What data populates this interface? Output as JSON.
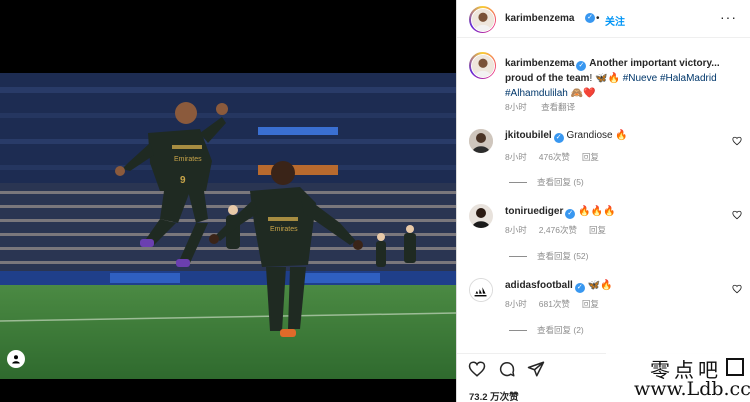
{
  "post": {
    "author": "karimbenzema",
    "follow_label": "关注",
    "caption_parts": [
      {
        "text": "Another important victory...",
        "bold": true
      },
      {
        "text": "proud of the team",
        "bold": true
      },
      {
        "text": "! 🦋🔥 ",
        "bold": false
      },
      {
        "text": "#Nueve",
        "tag": true
      },
      {
        "text": "#HalaMadrid",
        "tag": true
      },
      {
        "text": "#Alhamdulilah",
        "tag": true
      }
    ],
    "caption_line1": "Another important victory...",
    "caption_line2_bold": "proud of the team",
    "caption_line2_rest": "! 🦋🔥",
    "tag1": "#Nueve",
    "tag2": "#HalaMadrid",
    "tag3": "#Alhamdulilah",
    "caption_end_emoji": "🙈❤️",
    "time": "8小时",
    "translate_label": "查看翻译",
    "likes_label": "73.2 万次赞"
  },
  "comments": [
    {
      "user": "jkitoubilel",
      "verified": true,
      "text": "Grandiose 🔥",
      "time": "8小时",
      "likes": "476次赞",
      "reply": "回复",
      "view_replies": "查看回复 (5)"
    },
    {
      "user": "toniruediger",
      "verified": true,
      "text": "🔥🔥🔥",
      "time": "8小时",
      "likes": "2,476次赞",
      "reply": "回复",
      "view_replies": "查看回复 (52)"
    },
    {
      "user": "adidasfootball",
      "verified": true,
      "text": "🦋🔥",
      "time": "8小时",
      "likes": "681次赞",
      "reply": "回复",
      "view_replies": "查看回复 (2)"
    }
  ],
  "icons": {
    "more": "more-options-icon",
    "like": "heart-icon",
    "comment": "comment-icon",
    "share": "paper-plane-icon",
    "tag": "user-tag-icon"
  },
  "photo": {
    "jersey_text": "Emirates",
    "jersey_number": "9"
  },
  "watermark": {
    "cn": "零点吧",
    "url": "www.Ldb.cc"
  },
  "colors": {
    "accent": "#0095f6",
    "verified": "#3897f0",
    "pitch": "#3e7a3a",
    "kit": "#1f2a22"
  }
}
